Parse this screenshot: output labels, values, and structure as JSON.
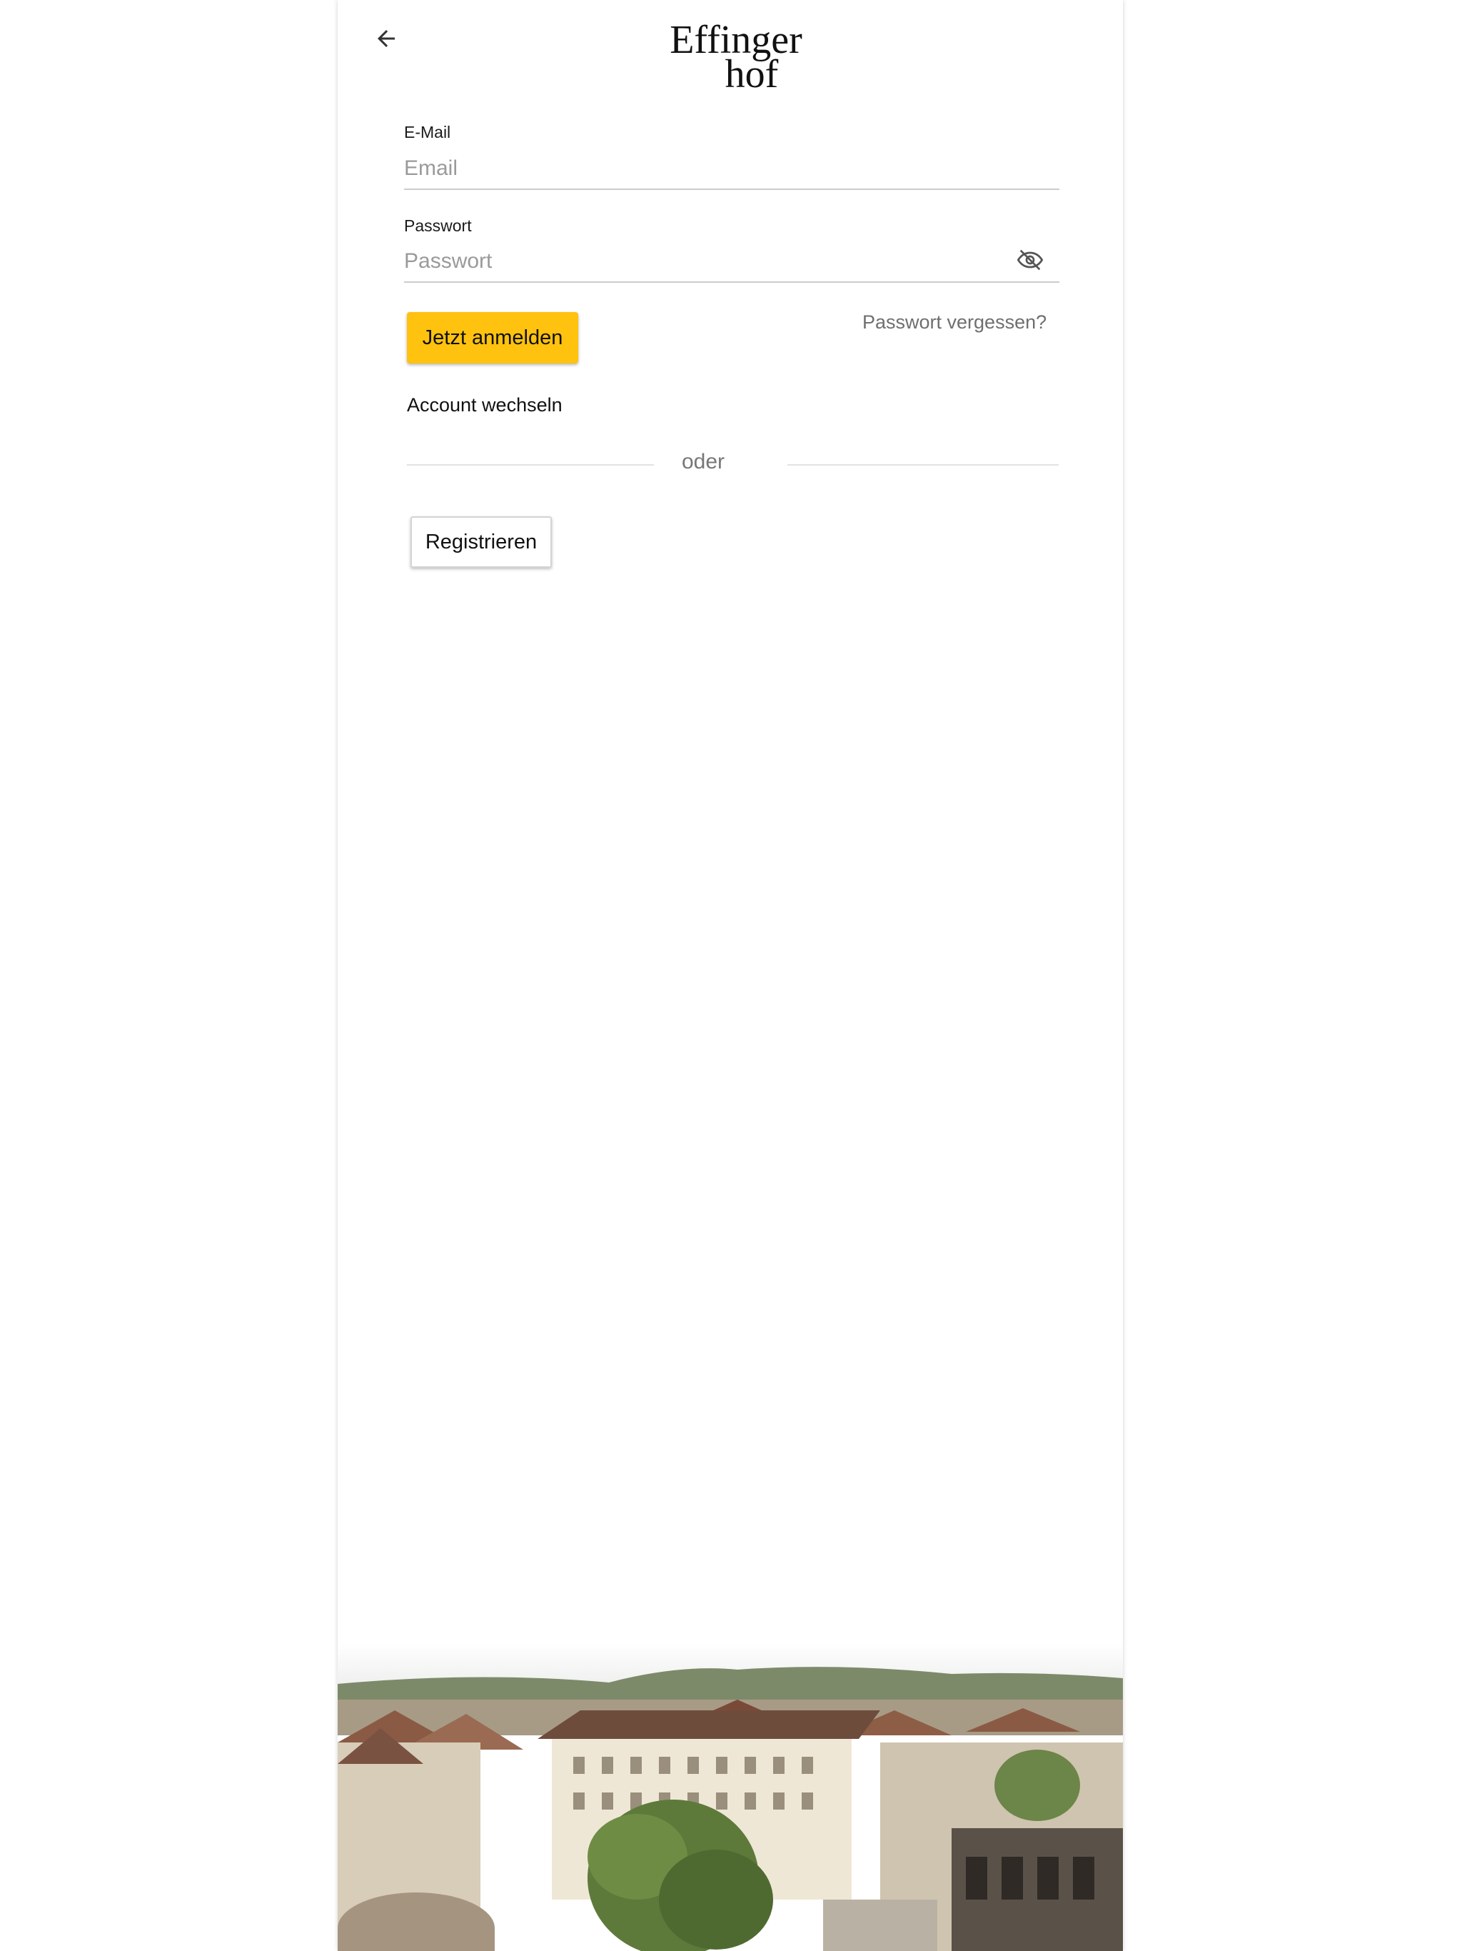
{
  "header": {
    "back_icon": "arrow-left-icon",
    "logo_line1": "Effinger",
    "logo_line2": "hof"
  },
  "form": {
    "email_label": "E-Mail",
    "email_placeholder": "Email",
    "email_value": "",
    "password_label": "Passwort",
    "password_placeholder": "Passwort",
    "password_value": "",
    "visibility_icon": "eye-off-icon",
    "login_label": "Jetzt anmelden",
    "forgot_label": "Passwort vergessen?",
    "switch_account_label": "Account wechseln",
    "divider_label": "oder",
    "register_label": "Registrieren"
  },
  "colors": {
    "accent": "#ffc20e",
    "text": "#111111",
    "muted": "#777777"
  },
  "background_image": "town-rooftops-photo"
}
